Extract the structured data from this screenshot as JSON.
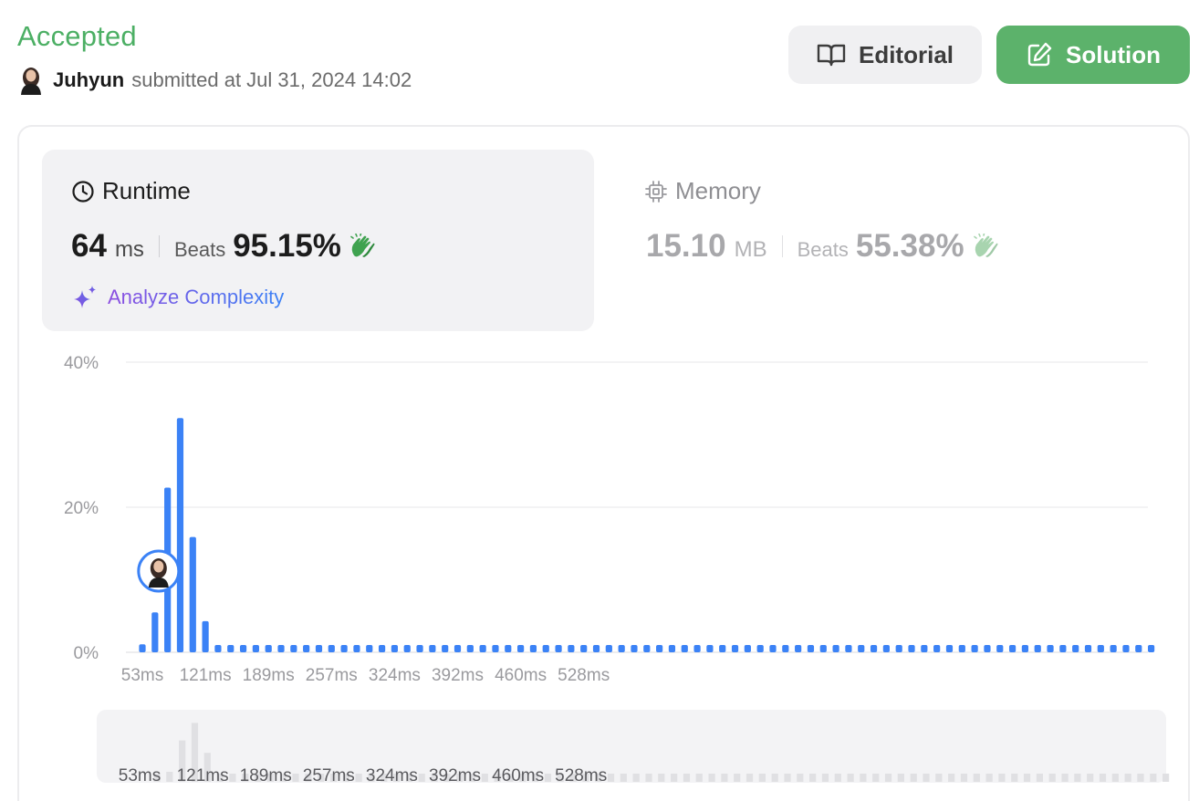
{
  "header": {
    "status": "Accepted",
    "user_name": "Juhyun",
    "submitted_text": "submitted at Jul 31, 2024 14:02",
    "editorial_label": "Editorial",
    "solution_label": "Solution",
    "colors": {
      "accepted": "#4caf64",
      "solution_button": "#5cb26b"
    }
  },
  "runtime": {
    "title": "Runtime",
    "value": "64",
    "unit": "ms",
    "beats_label": "Beats",
    "beats_pct": "95.15%",
    "analyze_label": "Analyze Complexity"
  },
  "memory": {
    "title": "Memory",
    "value": "15.10",
    "unit": "MB",
    "beats_label": "Beats",
    "beats_pct": "55.38%"
  },
  "chart_data": {
    "type": "bar",
    "x_tick_labels": [
      "53ms",
      "121ms",
      "189ms",
      "257ms",
      "324ms",
      "392ms",
      "460ms",
      "528ms"
    ],
    "y_tick_labels": [
      "40%",
      "20%",
      "0%"
    ],
    "ylim": [
      0,
      40
    ],
    "grid": true,
    "bar_color": "#3b82f6",
    "selected_bar_index": 1,
    "values": [
      1.1,
      5.5,
      22.7,
      32.3,
      15.9,
      4.3,
      1.0,
      1.0,
      1.0,
      1.0,
      1.0,
      1.0,
      1.0,
      1.0,
      1.0,
      1.0,
      1.0,
      1.0,
      1.0,
      1.0,
      1.0,
      1.0,
      1.0,
      1.0,
      1.0,
      1.0,
      1.0,
      1.0,
      1.0,
      1.0,
      1.0,
      1.0,
      1.0,
      1.0,
      1.0,
      1.0,
      1.0,
      1.0,
      1.0,
      1.0,
      1.0,
      1.0,
      1.0,
      1.0,
      1.0,
      1.0,
      1.0,
      1.0,
      1.0,
      1.0,
      1.0,
      1.0,
      1.0,
      1.0,
      1.0,
      1.0,
      1.0,
      1.0,
      1.0,
      1.0,
      1.0,
      1.0,
      1.0,
      1.0,
      1.0,
      1.0,
      1.0,
      1.0,
      1.0,
      1.0,
      1.0,
      1.0,
      1.0,
      1.0,
      1.0,
      1.0,
      1.0,
      1.0,
      1.0,
      1.0,
      1.0
    ]
  }
}
